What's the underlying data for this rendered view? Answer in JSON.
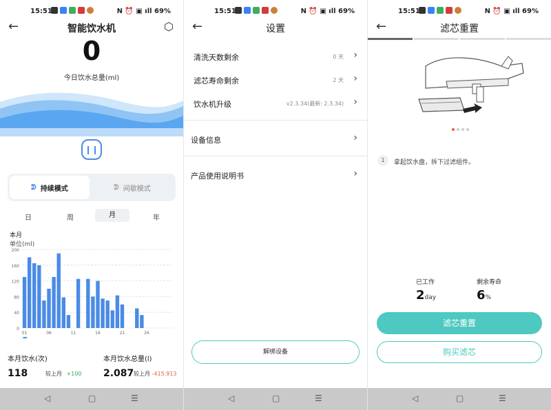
{
  "status": {
    "time": "15:51",
    "sys": "N ⏰ ▣ ıll 69%"
  },
  "screen1": {
    "title": "智能饮水机",
    "total_value": "0",
    "total_label": "今日饮水总量(ml)",
    "modes": [
      {
        "label": "持续模式",
        "active": true
      },
      {
        "label": "间歇模式",
        "active": false
      }
    ],
    "periods": [
      "日",
      "周",
      "月",
      "年"
    ],
    "active_period": "月",
    "chart_title": "本月",
    "unit_label": "单位(ml)",
    "stats": [
      {
        "label": "本月饮水(次)",
        "value": "118",
        "compare_label": "较上月",
        "compare_value": "+100"
      },
      {
        "label": "本月饮水总量(l)",
        "value": "2.087",
        "compare_label": "较上月",
        "compare_value": "-415.913"
      }
    ]
  },
  "screen2": {
    "title": "设置",
    "items": [
      {
        "label": "清洗天数剩余",
        "value": "0 天"
      },
      {
        "label": "滤芯寿命剩余",
        "value": "2 天"
      },
      {
        "label": "饮水机升级",
        "value": "v2.3.34(最新: 2.3.34)"
      }
    ],
    "device_info": "设备信息",
    "manual": "产品使用说明书",
    "unbind_button": "解绑设备"
  },
  "screen3": {
    "title": "滤芯重置",
    "step_number": "1",
    "step_text": "拿起饮水盘，拆下过滤组件。",
    "worked_label": "已工作",
    "worked_value": "2",
    "worked_unit": "day",
    "remaining_label": "剩余寿命",
    "remaining_value": "6",
    "remaining_unit": "%",
    "reset_button": "滤芯重置",
    "buy_button": "购买滤芯"
  },
  "colors": {
    "accent": "#4dc9c1",
    "bar": "#4a8be5",
    "wave": "#5aa6f0",
    "positive": "#2eaa5a",
    "negative": "#e0603a"
  },
  "chart_data": {
    "type": "bar",
    "title": "本月",
    "ylabel": "单位(ml)",
    "ylim": [
      0,
      200
    ],
    "yticks": [
      0,
      40,
      80,
      120,
      160,
      200
    ],
    "xticks": [
      "01",
      "06",
      "11",
      "16",
      "21",
      "26"
    ],
    "x": [
      1,
      2,
      3,
      4,
      5,
      6,
      7,
      8,
      9,
      10,
      11,
      12,
      13,
      14,
      15,
      16,
      17,
      18,
      19,
      20,
      21,
      22,
      23,
      24,
      25,
      26,
      27,
      28,
      29,
      30,
      31
    ],
    "values": [
      130,
      180,
      165,
      160,
      70,
      100,
      130,
      190,
      78,
      33,
      0,
      125,
      0,
      125,
      80,
      120,
      75,
      70,
      45,
      83,
      60,
      0,
      0,
      50,
      33,
      0,
      0,
      0,
      0,
      0,
      0
    ]
  }
}
